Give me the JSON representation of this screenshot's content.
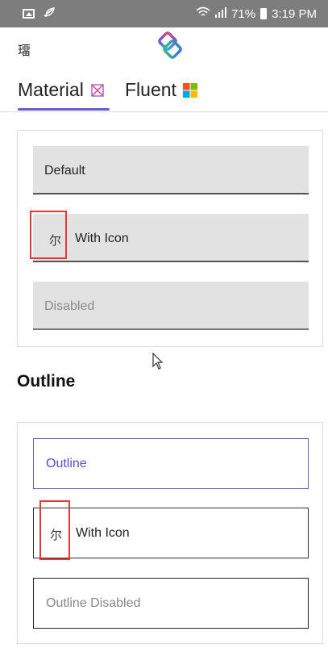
{
  "status_bar": {
    "battery": "71%",
    "time": "3:19 PM"
  },
  "app_bar": {
    "menu_glyph": "璢",
    "logo": "app-logo"
  },
  "tabs": [
    {
      "label": "Material",
      "selected": true
    },
    {
      "label": "Fluent",
      "selected": false
    }
  ],
  "filled_section": {
    "fields": [
      {
        "label": "Default",
        "disabled": false
      },
      {
        "label": "With Icon",
        "icon_glyph": "尔",
        "disabled": false
      },
      {
        "label": "Disabled",
        "disabled": true
      }
    ]
  },
  "outline_section": {
    "title": "Outline",
    "fields": [
      {
        "label": "Outline",
        "focused": true
      },
      {
        "label": "With Icon",
        "icon_glyph": "尔"
      },
      {
        "label": "Outline Disabled",
        "disabled": true
      }
    ]
  },
  "colors": {
    "accent": "#6a5acd",
    "status_bar": "#7d7d7d",
    "highlight": "#e53935"
  }
}
